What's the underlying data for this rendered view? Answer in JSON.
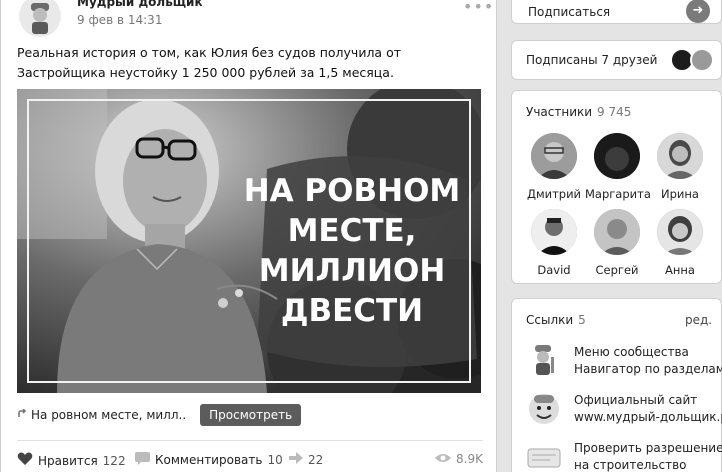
{
  "post": {
    "author": "Мудрый дольщик",
    "date": "9 фев в 14:31",
    "more": "•••",
    "text": "Реальная история о том, как Юлия без судов получила от Застройщика неустойку 1 250 000 рублей за 1,5 месяца.",
    "image_headline": [
      "НА РОВНОМ",
      "МЕСТЕ,",
      "МИЛЛИОН",
      "ДВЕСТИ"
    ],
    "link_title": "На ровном месте, милл..",
    "view_button": "Просмотреть",
    "actions": {
      "like_label": "Нравится",
      "like_count": "122",
      "comment_label": "Комментировать",
      "comment_count": "10",
      "share_count": "22",
      "views": "8.9K"
    }
  },
  "sidebar": {
    "subscribe_label": "Подписаться",
    "friends_label": "Подписаны 7 друзей",
    "members": {
      "title": "Участники",
      "count": "9 745",
      "items": [
        {
          "name": "Дмитрий"
        },
        {
          "name": "Маргарита"
        },
        {
          "name": "Ирина"
        },
        {
          "name": "David"
        },
        {
          "name": "Сергей"
        },
        {
          "name": "Анна"
        }
      ]
    },
    "links": {
      "title": "Ссылки",
      "count": "5",
      "edit": "ред.",
      "items": [
        {
          "line1": "Меню сообщества",
          "line2": "Навигатор по разделам"
        },
        {
          "line1": "Официальный сайт",
          "line2": "www.мудрый-дольщик.рф"
        },
        {
          "line1": "Проверить разрешение",
          "line2": "на строительство"
        }
      ]
    }
  },
  "icons": {
    "link": "link-arrow-icon",
    "like": "heart-icon",
    "comment": "comment-icon",
    "share": "share-icon",
    "views": "eye-icon",
    "subscribe": "arrow-right-icon"
  }
}
